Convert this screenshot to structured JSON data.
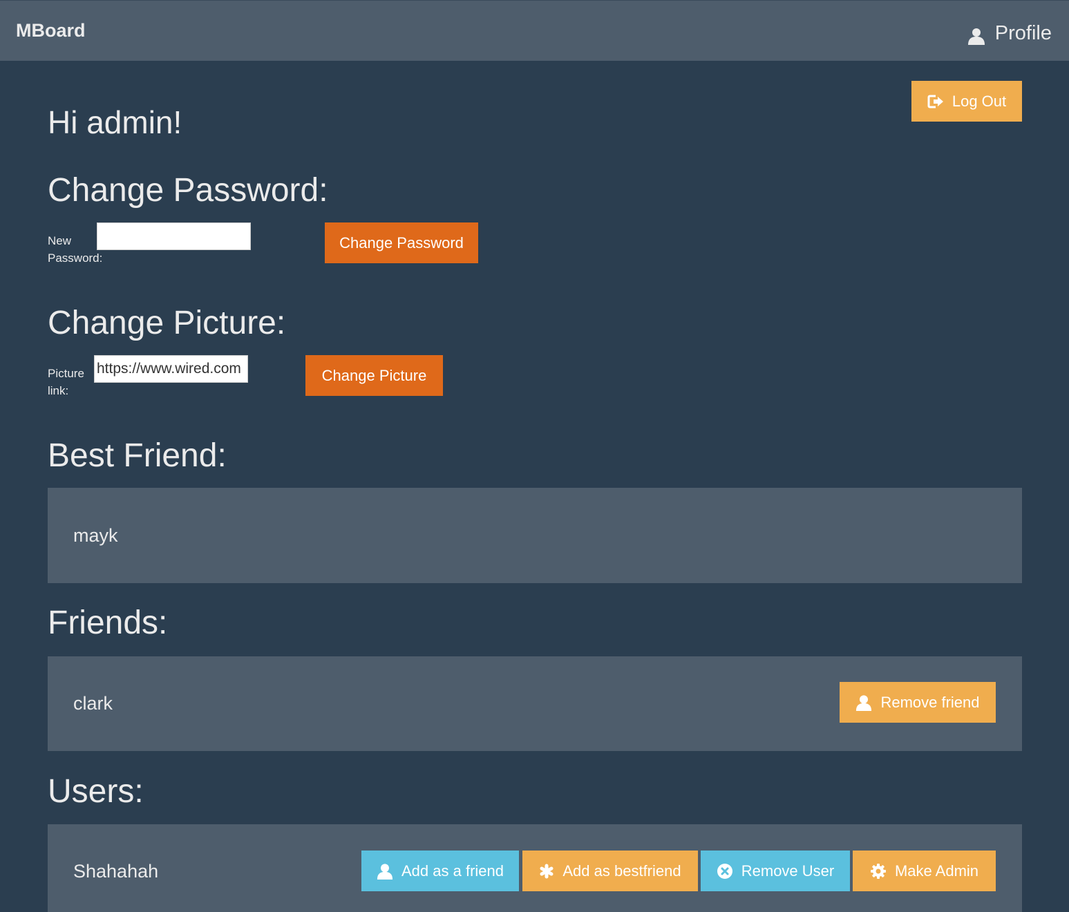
{
  "navbar": {
    "brand": "MBoard",
    "profile_label": "Profile",
    "profile_icon": "user-icon"
  },
  "logout": {
    "label": "Log Out",
    "icon": "sign-out-icon"
  },
  "greeting": "Hi admin!",
  "change_password": {
    "heading": "Change Password:",
    "label_line1": "New",
    "label_line2": "Password:",
    "value": "",
    "button_label": "Change Password"
  },
  "change_picture": {
    "heading": "Change Picture:",
    "label_line1": "Picture",
    "label_line2": "link:",
    "value": "https://www.wired.com",
    "button_label": "Change Picture"
  },
  "best_friend": {
    "heading": "Best Friend:",
    "name": "mayk"
  },
  "friends": {
    "heading": "Friends:",
    "items": [
      {
        "name": "clark",
        "remove_label": "Remove friend",
        "remove_icon": "user-icon"
      }
    ]
  },
  "users": {
    "heading": "Users:",
    "items": [
      {
        "name": "Shahahah",
        "add_friend_label": "Add as a friend",
        "add_bestfriend_label": "Add as bestfriend",
        "remove_user_label": "Remove User",
        "make_admin_label": "Make Admin"
      }
    ]
  },
  "colors": {
    "background": "#2b3e50",
    "navbar": "#4e5d6c",
    "well": "#4e5d6c",
    "warning": "#f0ad4e",
    "primary": "#df691a",
    "info": "#5bc0de"
  }
}
